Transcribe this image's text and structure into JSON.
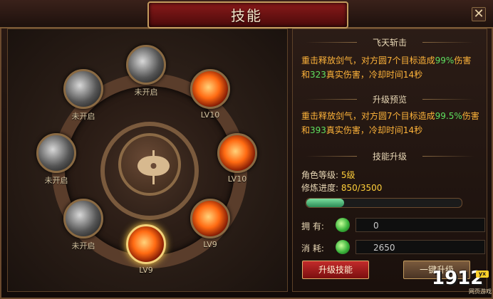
{
  "window": {
    "title": "技能",
    "close_symbol": "✕"
  },
  "skills": [
    {
      "id": "top",
      "label": "未开启",
      "state": "locked"
    },
    {
      "id": "upper-right",
      "label": "LV10",
      "state": "active"
    },
    {
      "id": "right",
      "label": "LV10",
      "state": "active"
    },
    {
      "id": "lower-right",
      "label": "LV9",
      "state": "active"
    },
    {
      "id": "bottom",
      "label": "LV9",
      "state": "selected"
    },
    {
      "id": "lower-left",
      "label": "未开启",
      "state": "locked"
    },
    {
      "id": "left",
      "label": "未开启",
      "state": "locked"
    },
    {
      "id": "upper-left",
      "label": "未开启",
      "state": "locked"
    }
  ],
  "center": {
    "icon": "axe-icon"
  },
  "skill_detail": {
    "name": "飞天斩击",
    "current": {
      "prefix": "重击释放剑气，对方圆7个目标造成",
      "percent": "99%",
      "mid": "伤害和",
      "dmg": "323",
      "suffix": "真实伤害，冷却时间14秒"
    },
    "preview_title": "升级预览",
    "preview": {
      "prefix": "重击释放剑气，对方圆7个目标造成",
      "percent": "99.5%",
      "mid": "伤害和",
      "dmg": "393",
      "suffix": "真实伤害，冷却时间14秒"
    }
  },
  "upgrade": {
    "title": "技能升级",
    "role_level_label": "角色等级:",
    "role_level_value": "5级",
    "progress_label": "修炼进度:",
    "progress_value": "850/3500",
    "progress_fraction": 0.243,
    "own_label": "拥 有:",
    "own_value": "0",
    "cost_label": "消 耗:",
    "cost_value": "2650",
    "upgrade_button": "升级技能",
    "one_click_button": "一键升级"
  },
  "watermark": {
    "number": "1912",
    "badge": "yx",
    "sub": "网页游戏"
  },
  "colors": {
    "accent_gold": "#c39b5e",
    "text_orange": "#ffb43a",
    "text_green": "#5fe05f",
    "value_yellow": "#ffcf3a",
    "button_red": "#c22b2b"
  }
}
